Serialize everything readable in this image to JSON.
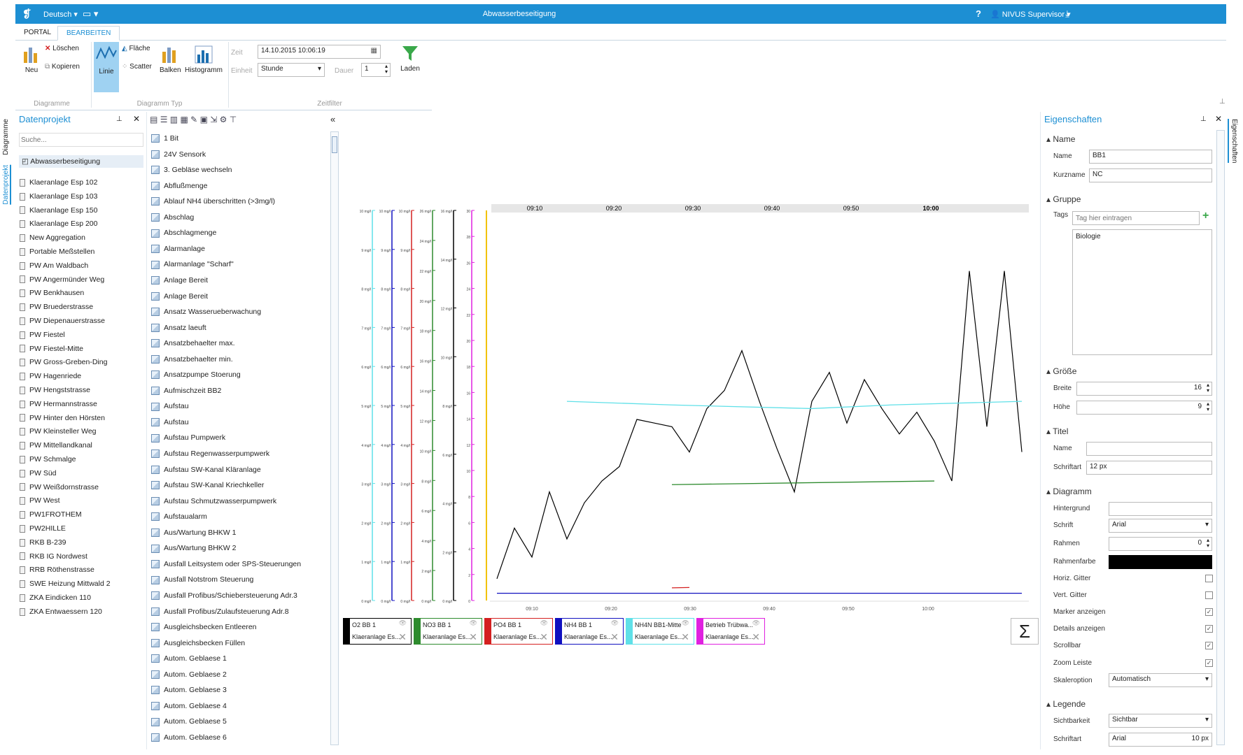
{
  "titlebar": {
    "language": "Deutsch",
    "title": "Abwasserbeseitigung",
    "help": "?",
    "user": "NIVUS Supervisor"
  },
  "ribbon": {
    "tabs": [
      "PORTAL",
      "BEARBEITEN"
    ],
    "diagramme": {
      "new": "Neu",
      "delete": "Löschen",
      "copy": "Kopieren",
      "label": "Diagramme"
    },
    "typ": {
      "line": "Linie",
      "area": "Fläche",
      "scatter": "Scatter",
      "bars": "Balken",
      "histogram": "Histogramm",
      "label": "Diagramm Typ"
    },
    "zeitfilter": {
      "zeit_label": "Zeit",
      "zeit_value": "14.10.2015 10:06:19",
      "einheit_label": "Einheit",
      "einheit_value": "Stunde",
      "dauer_label": "Dauer",
      "dauer_value": "1",
      "load": "Laden",
      "label": "Zeitfilter"
    }
  },
  "leftstrip": {
    "tab1": "Diagramme",
    "tab2": "Datenprojekt"
  },
  "datenprojekt": {
    "title": "Datenprojekt",
    "search_placeholder": "Suche...",
    "root": "Abwasserbeseitigung",
    "items": [
      "Klaeranlage Esp 102",
      "Klaeranlage Esp 103",
      "Klaeranlage Esp 150",
      "Klaeranlage Esp 200",
      "New Aggregation",
      "Portable Meßstellen",
      "PW Am Waldbach",
      "PW Angermünder Weg",
      "PW Benkhausen",
      "PW Bruederstrasse",
      "PW Diepenauerstrasse",
      "PW Fiestel",
      "PW Fiestel-Mitte",
      "PW Gross-Greben-Ding",
      "PW Hagenriede",
      "PW Hengststrasse",
      "PW Hermannstrasse",
      "PW Hinter den Hörsten",
      "PW Kleinsteller Weg",
      "PW Mittellandkanal",
      "PW Schmalge",
      "PW Süd",
      "PW Weißdornstrasse",
      "PW West",
      "PW1FROTHEM",
      "PW2HILLE",
      "RKB B-239",
      "RKB IG Nordwest",
      "RRB Röthenstrasse",
      "SWE Heizung Mittwald 2",
      "ZKA Eindicken 110",
      "ZKA Entwaessern 120"
    ]
  },
  "signals": [
    "1 Bit",
    "24V Sensork",
    "3. Gebläse wechseln",
    "Abflußmenge",
    "Ablauf NH4 überschritten (>3mg/l)",
    "Abschlag",
    "Abschlagmenge",
    "Alarmanlage",
    "Alarmanlage \"Scharf\"",
    "Anlage Bereit",
    "Anlage Bereit",
    "Ansatz Wasserueberwachung",
    "Ansatz laeuft",
    "Ansatzbehaelter max.",
    "Ansatzbehaelter min.",
    "Ansatzpumpe Stoerung",
    "Aufmischzeit BB2",
    "Aufstau",
    "Aufstau",
    "Aufstau Pumpwerk",
    "Aufstau Regenwasserpumpwerk",
    "Aufstau SW-Kanal Kläranlage",
    "Aufstau SW-Kanal Kriechkeller",
    "Aufstau Schmutzwasserpumpwerk",
    "Aufstaualarm",
    "Aus/Wartung BHKW 1",
    "Aus/Wartung BHKW 2",
    "Ausfall Leitsystem oder SPS-Steuerungen",
    "Ausfall Notstrom Steuerung",
    "Ausfall Profibus/Schiebersteuerung Adr.3",
    "Ausfall Profibus/Zulaufsteuerung Adr.8",
    "Ausgleichsbecken Entleeren",
    "Ausgleichsbecken Füllen",
    "Autom. Geblaese 1",
    "Autom. Geblaese 2",
    "Autom. Geblaese 3",
    "Autom. Geblaese 4",
    "Autom. Geblaese 5",
    "Autom. Geblaese 6"
  ],
  "chart_data": {
    "type": "line",
    "x_top_ticks": [
      "09:10",
      "09:20",
      "09:30",
      "09:40",
      "09:50",
      "10:00"
    ],
    "x_bottom_ticks": [
      "09:10",
      "09:20",
      "09:30",
      "09:40",
      "09:50",
      "10:00"
    ],
    "axis1_ticks": [
      "10 mg/l",
      "9 mg/l",
      "8 mg/l",
      "7 mg/l",
      "6 mg/l",
      "5 mg/l",
      "4 mg/l",
      "3 mg/l",
      "2 mg/l",
      "1 mg/l",
      "0 mg/l"
    ],
    "axis2_ticks": [
      "10 mg/l",
      "9 mg/l",
      "8 mg/l",
      "7 mg/l",
      "6 mg/l",
      "5 mg/l",
      "4 mg/l",
      "3 mg/l",
      "2 mg/l",
      "1 mg/l",
      "0 mg/l"
    ],
    "axis3_ticks": [
      "10 mg/l",
      "9 mg/l",
      "8 mg/l",
      "7 mg/l",
      "6 mg/l",
      "5 mg/l",
      "4 mg/l",
      "3 mg/l",
      "2 mg/l",
      "1 mg/l",
      "0 mg/l"
    ],
    "axis4_ticks": [
      "26 mg/l",
      "24 mg/l",
      "22 mg/l",
      "20 mg/l",
      "18 mg/l",
      "16 mg/l",
      "14 mg/l",
      "12 mg/l",
      "10 mg/l",
      "8 mg/l",
      "6 mg/l",
      "4 mg/l",
      "2 mg/l",
      "0 mg/l"
    ],
    "axis5_ticks": [
      "16 mg/l",
      "14 mg/l",
      "12 mg/l",
      "10 mg/l",
      "8 mg/l",
      "6 mg/l",
      "4 mg/l",
      "2 mg/l",
      "0 mg/l"
    ],
    "axis6_ticks": [
      "30",
      "28",
      "26",
      "24",
      "22",
      "20",
      "18",
      "16",
      "14",
      "12",
      "10",
      "8",
      "6",
      "4",
      "2",
      "0"
    ],
    "series": [
      {
        "name": "O2 BB 1",
        "color": "#000000",
        "x_minutes": [
          0,
          2,
          4,
          6,
          8,
          10,
          12,
          14,
          16,
          18,
          20,
          22,
          24,
          26,
          28,
          30,
          32,
          34,
          36,
          38,
          40,
          42,
          44,
          46,
          48,
          50,
          52,
          54,
          56,
          58,
          60
        ],
        "values": [
          0.6,
          2.0,
          1.2,
          3.0,
          1.7,
          2.7,
          3.3,
          3.7,
          5.0,
          4.9,
          4.8,
          4.1,
          5.3,
          5.8,
          6.9,
          5.5,
          4.2,
          3.0,
          5.5,
          6.3,
          4.9,
          6.1,
          5.3,
          4.6,
          5.2,
          4.4,
          3.3,
          9.1,
          4.8,
          9.1,
          4.1
        ],
        "x_minutes_note": "approximate"
      },
      {
        "name": "NO3 BB 1",
        "color": "#2e8b2e",
        "x_minutes": [
          20,
          50
        ],
        "values": [
          3.2,
          3.3
        ]
      },
      {
        "name": "PO4 BB 1",
        "color": "#d42020",
        "x_minutes": [
          20,
          22
        ],
        "values": [
          0.35,
          0.36
        ]
      },
      {
        "name": "NH4 BB 1",
        "color": "#1010c0",
        "x_minutes": [
          0,
          60
        ],
        "values": [
          0.2,
          0.2
        ]
      },
      {
        "name": "NH4N BB1-Mitte",
        "color": "#5fe0e8",
        "x_minutes": [
          8,
          20,
          36,
          45,
          60
        ],
        "values": [
          5.5,
          5.4,
          5.3,
          5.4,
          5.5
        ]
      },
      {
        "name": "Betrieb Trübwa...",
        "color": "#e020e0",
        "x_minutes": [],
        "values": []
      }
    ],
    "legend": [
      {
        "name": "O2 BB 1",
        "sub": "Klaeranlage Es...",
        "color": "#000000"
      },
      {
        "name": "NO3 BB 1",
        "sub": "Klaeranlage Es...",
        "color": "#2e8b2e"
      },
      {
        "name": "PO4 BB 1",
        "sub": "Klaeranlage Es...",
        "color": "#d42020"
      },
      {
        "name": "NH4 BB 1",
        "sub": "Klaeranlage Es...",
        "color": "#1010c0"
      },
      {
        "name": "NH4N BB1-Mitte",
        "sub": "Klaeranlage Es...",
        "color": "#5fe0e8"
      },
      {
        "name": "Betrieb Trübwa...",
        "sub": "Klaeranlage Es...",
        "color": "#e020e0"
      }
    ],
    "ylim": [
      0,
      10
    ],
    "sum_button": "Σ"
  },
  "properties": {
    "title": "Eigenschaften",
    "vertical_tab": "Eigenschaften",
    "name_section": "Name",
    "name_label": "Name",
    "name_value": "BB1",
    "short_label": "Kurzname",
    "short_value": "NC",
    "group_section": "Gruppe",
    "tags_label": "Tags",
    "tags_placeholder": "Tag hier eintragen",
    "tag_list_item": "Biologie",
    "size_section": "Größe",
    "width_label": "Breite",
    "width_value": "16",
    "height_label": "Höhe",
    "height_value": "9",
    "title_section": "Titel",
    "tname_label": "Name",
    "tname_value": "",
    "tfont_label": "Schriftart",
    "tfont_value": "12 px",
    "diagram_section": "Diagramm",
    "bg_label": "Hintergrund",
    "font_label": "Schrift",
    "font_value": "Arial",
    "frame_label": "Rahmen",
    "frame_value": "0",
    "framecolor_label": "Rahmenfarbe",
    "framecolor": "#000000",
    "hgrid_label": "Horiz. Gitter",
    "hgrid": false,
    "vgrid_label": "Vert. Gitter",
    "vgrid": false,
    "marker_label": "Marker anzeigen",
    "marker": true,
    "details_label": "Details anzeigen",
    "details": true,
    "scroll_label": "Scrollbar",
    "scroll": true,
    "zoom_label": "Zoom Leiste",
    "zoom": true,
    "scale_label": "Skaleroption",
    "scale_value": "Automatisch",
    "legend_section": "Legende",
    "vis_label": "Sichtbarkeit",
    "vis_value": "Sichtbar",
    "lfont_label": "Schriftart",
    "lfont_value": "Arial",
    "lfont_size": "10 px"
  }
}
